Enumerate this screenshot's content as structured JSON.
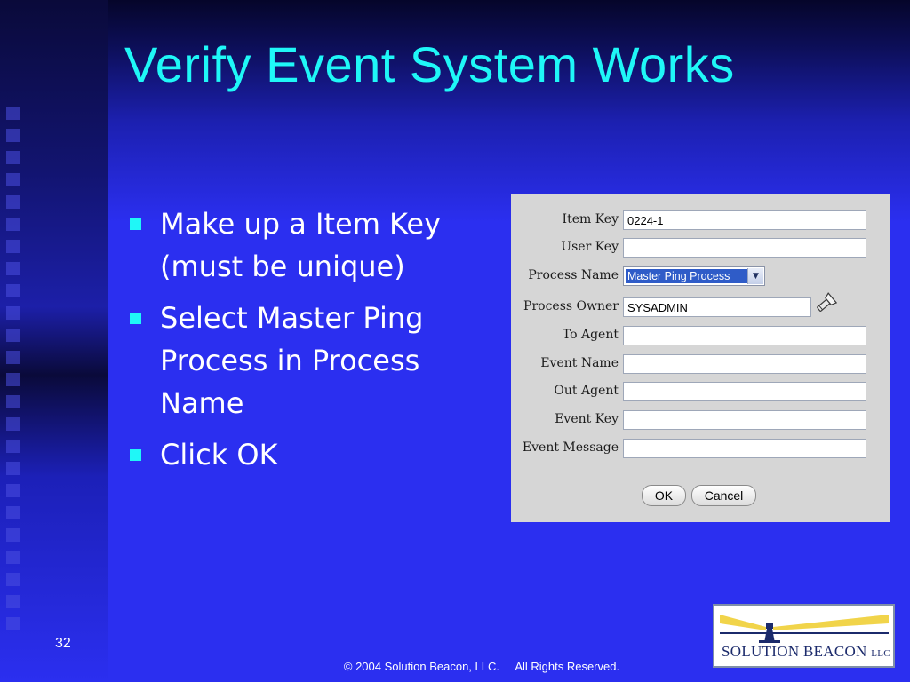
{
  "slide": {
    "title": "Verify Event System Works",
    "bullets": [
      "Make up a Item Key (must be unique)",
      "Select Master Ping Process in Process Name",
      "Click OK"
    ],
    "page_number": "32",
    "copyright": "© 2004 Solution Beacon, LLC.     All Rights Reserved."
  },
  "form": {
    "fields": [
      {
        "label": "Item Key",
        "value": "0224-1"
      },
      {
        "label": "User Key",
        "value": ""
      },
      {
        "label": "Process Name",
        "value": "Master Ping Process"
      },
      {
        "label": "Process Owner",
        "value": "SYSADMIN"
      },
      {
        "label": "To Agent",
        "value": ""
      },
      {
        "label": "Event Name",
        "value": ""
      },
      {
        "label": "Out Agent",
        "value": ""
      },
      {
        "label": "Event Key",
        "value": ""
      },
      {
        "label": "Event Message",
        "value": ""
      }
    ],
    "ok_label": "OK",
    "cancel_label": "Cancel"
  },
  "logo": {
    "text": "SOLUTION BEACON",
    "suffix": "LLC"
  },
  "colors": {
    "background": "#2b2ff0",
    "title": "#1ff7f7",
    "bullet_marker": "#1ff7f7",
    "form_background": "#d6d6d6",
    "select_highlight": "#2f5cc8"
  },
  "icons": {
    "bullet": "square-bullet",
    "process_owner_lookup": "flashlight-icon",
    "select_dropdown": "chevron-down-icon"
  }
}
